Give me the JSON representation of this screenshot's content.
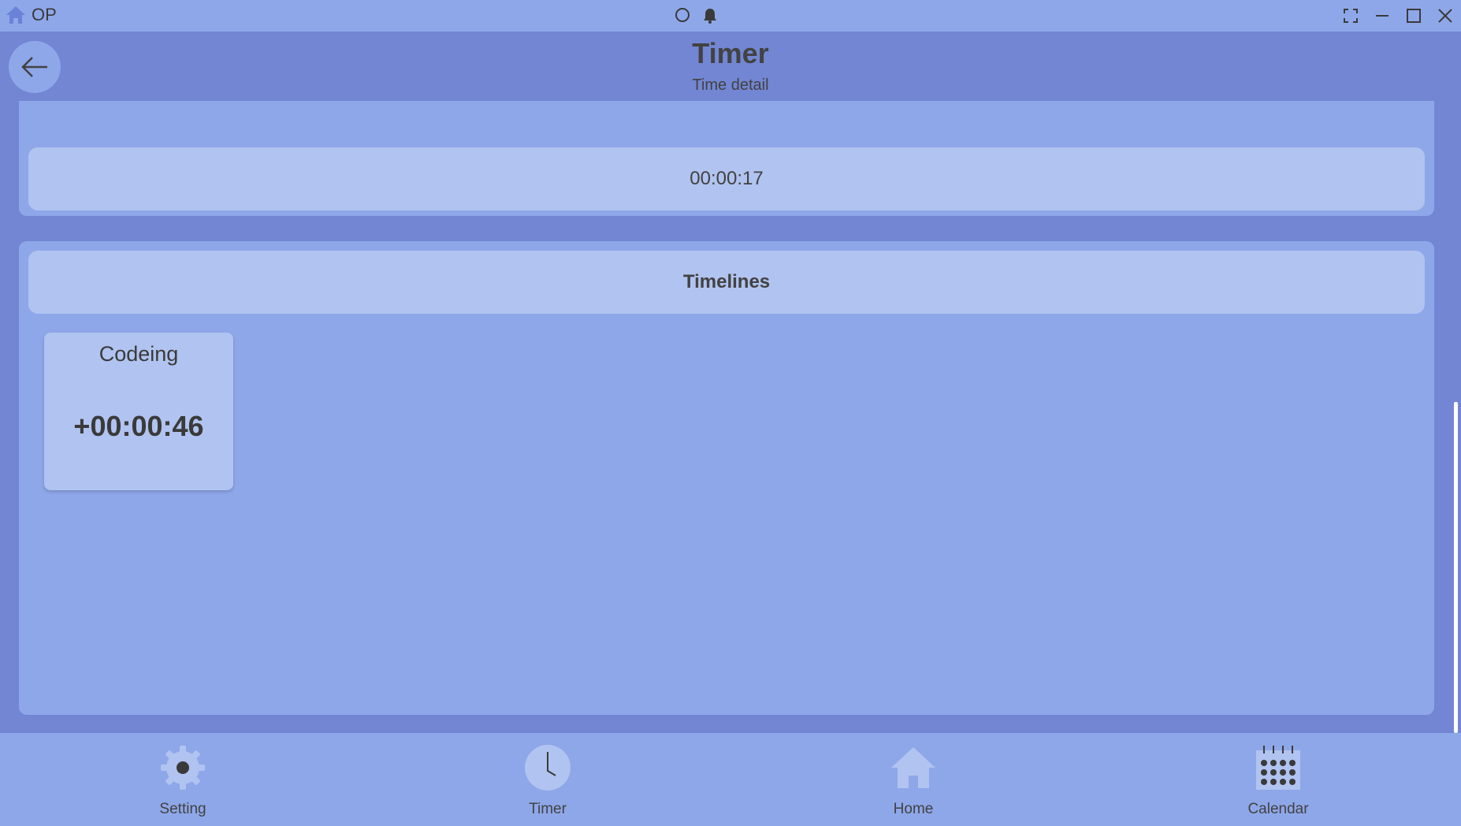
{
  "titlebar": {
    "app_name": "OP",
    "icons": [
      "home-icon",
      "search-icon",
      "bell-icon",
      "fullscreen-icon",
      "minimize-icon",
      "maximize-icon",
      "close-icon"
    ]
  },
  "header": {
    "title": "Timer",
    "subtitle": "Time detail",
    "back_icon": "arrow-left-icon"
  },
  "main": {
    "elapsed": "00:00:17",
    "timelines_title": "Timelines",
    "timelines": [
      {
        "name": "Codeing",
        "time": "+00:00:46"
      }
    ]
  },
  "bottom_nav": {
    "items": [
      {
        "label": "Setting",
        "icon": "gear-icon"
      },
      {
        "label": "Timer",
        "icon": "clock-icon"
      },
      {
        "label": "Home",
        "icon": "home-icon"
      },
      {
        "label": "Calendar",
        "icon": "calendar-icon"
      }
    ]
  },
  "colors": {
    "background": "#8ea7e9",
    "header": "#7286d3",
    "card_light": "#b1c3f0",
    "text": "#424242"
  }
}
